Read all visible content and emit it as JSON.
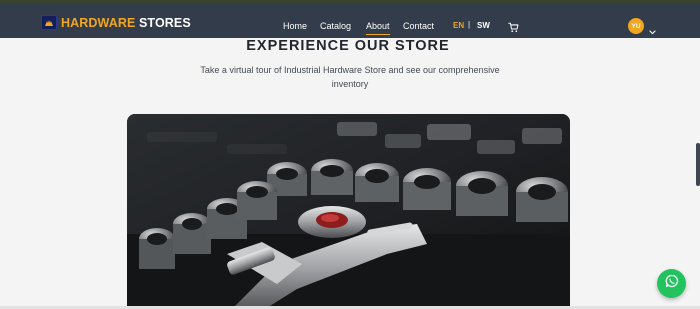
{
  "brand": {
    "name_part1": "HARDWARE",
    "name_part2": "STORES"
  },
  "nav": {
    "items": [
      {
        "label": "Home"
      },
      {
        "label": "Catalog"
      },
      {
        "label": "About"
      },
      {
        "label": "Contact"
      }
    ],
    "active": "About",
    "lang": {
      "en": "EN",
      "separator": "|",
      "sw": "SW"
    },
    "user_initials": "YU"
  },
  "colors": {
    "accent": "#f2a51f",
    "navbar": "#333c4a",
    "chat": "#22c35e"
  },
  "icons": [
    "cart-icon",
    "chevron-down-icon",
    "chat-icon",
    "tools-icon"
  ],
  "section": {
    "title": "EXPERIENCE OUR STORE",
    "subtitle": "Take a virtual tour of Industrial Hardware Store and see our comprehensive inventory"
  }
}
